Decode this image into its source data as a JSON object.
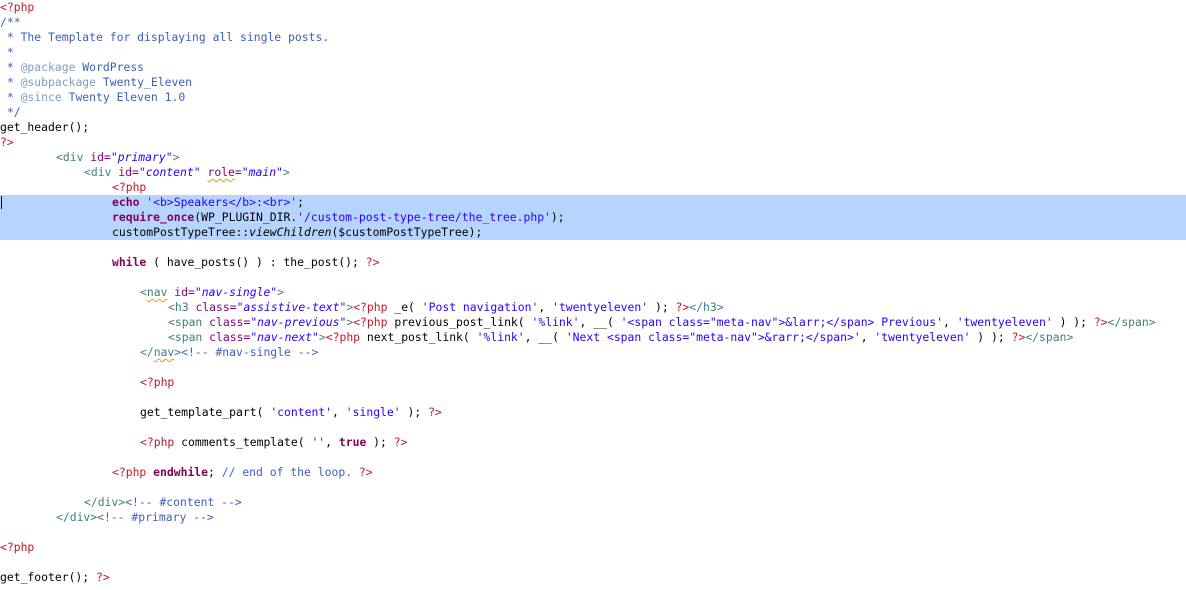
{
  "editor": {
    "language": "php",
    "selection_color": "#b5d5ff",
    "colors": {
      "php_tag": "#c0182a",
      "comment": "#3a5fbf",
      "doc_tag": "#7f9fbf",
      "keyword": "#7f0055",
      "string": "#2a00ff",
      "html_tag": "#3f7f7f",
      "html_attr": "#7f007f"
    },
    "lines": [
      {
        "indent": 0,
        "tokens": [
          {
            "t": "<?php",
            "c": "php-tag"
          }
        ]
      },
      {
        "indent": 0,
        "tokens": [
          {
            "t": "/**",
            "c": "cmt"
          }
        ]
      },
      {
        "indent": 0,
        "tokens": [
          {
            "t": " * The Template for displaying all single posts.",
            "c": "cmt"
          }
        ]
      },
      {
        "indent": 0,
        "tokens": [
          {
            "t": " *",
            "c": "cmt"
          }
        ]
      },
      {
        "indent": 0,
        "tokens": [
          {
            "t": " * ",
            "c": "cmt"
          },
          {
            "t": "@package",
            "c": "doc-tag"
          },
          {
            "t": " WordPress",
            "c": "cmt"
          }
        ]
      },
      {
        "indent": 0,
        "tokens": [
          {
            "t": " * ",
            "c": "cmt"
          },
          {
            "t": "@subpackage",
            "c": "doc-tag"
          },
          {
            "t": " Twenty_Eleven",
            "c": "cmt"
          }
        ]
      },
      {
        "indent": 0,
        "tokens": [
          {
            "t": " * ",
            "c": "cmt"
          },
          {
            "t": "@since",
            "c": "doc-tag"
          },
          {
            "t": " Twenty Eleven 1.0",
            "c": "cmt"
          }
        ]
      },
      {
        "indent": 0,
        "tokens": [
          {
            "t": " */",
            "c": "cmt"
          }
        ]
      },
      {
        "indent": 0,
        "tokens": [
          {
            "t": "get_header();",
            "c": "ident"
          }
        ]
      },
      {
        "indent": 0,
        "tokens": [
          {
            "t": "?>",
            "c": "php-tag"
          }
        ]
      },
      {
        "indent": 8,
        "tokens": [
          {
            "t": "<div ",
            "c": "html-tag"
          },
          {
            "t": "id=",
            "c": "attr"
          },
          {
            "t": "\"primary\"",
            "c": "attr-val"
          },
          {
            "t": ">",
            "c": "html-tag"
          }
        ]
      },
      {
        "indent": 12,
        "tokens": [
          {
            "t": "<div ",
            "c": "html-tag"
          },
          {
            "t": "id=",
            "c": "attr"
          },
          {
            "t": "\"content\"",
            "c": "attr-val"
          },
          {
            "t": " ",
            "c": "ident"
          },
          {
            "t": "role",
            "c": "attr squig"
          },
          {
            "t": "=",
            "c": "attr"
          },
          {
            "t": "\"main\"",
            "c": "attr-val"
          },
          {
            "t": ">",
            "c": "html-tag"
          }
        ]
      },
      {
        "indent": 16,
        "tokens": [
          {
            "t": "<?php",
            "c": "php-tag"
          }
        ]
      },
      {
        "indent": 16,
        "selected": true,
        "caret": true,
        "tokens": [
          {
            "t": "echo",
            "c": "kw"
          },
          {
            "t": " ",
            "c": "ident"
          },
          {
            "t": "'<b>Speakers</b>:<br>'",
            "c": "str"
          },
          {
            "t": ";",
            "c": "ident"
          }
        ]
      },
      {
        "indent": 16,
        "selected": true,
        "tokens": [
          {
            "t": "require_once",
            "c": "kw"
          },
          {
            "t": "(WP_PLUGIN_DIR.",
            "c": "ident"
          },
          {
            "t": "'/custom-post-type-tree/the_tree.php'",
            "c": "str"
          },
          {
            "t": ");",
            "c": "ident"
          }
        ]
      },
      {
        "indent": 16,
        "selected": true,
        "tokens": [
          {
            "t": "customPostTypeTree::",
            "c": "ident"
          },
          {
            "t": "viewChildren",
            "c": "ident ital"
          },
          {
            "t": "($customPostTypeTree);",
            "c": "ident"
          }
        ]
      },
      {
        "indent": 0,
        "tokens": []
      },
      {
        "indent": 16,
        "tokens": [
          {
            "t": "while",
            "c": "kw"
          },
          {
            "t": " ( have_posts() ) : the_post(); ",
            "c": "ident"
          },
          {
            "t": "?>",
            "c": "php-tag"
          }
        ]
      },
      {
        "indent": 0,
        "tokens": []
      },
      {
        "indent": 20,
        "tokens": [
          {
            "t": "<",
            "c": "html-tag"
          },
          {
            "t": "nav",
            "c": "html-tag squig"
          },
          {
            "t": " ",
            "c": "html-tag"
          },
          {
            "t": "id=",
            "c": "attr"
          },
          {
            "t": "\"nav-single\"",
            "c": "attr-val"
          },
          {
            "t": ">",
            "c": "html-tag"
          }
        ]
      },
      {
        "indent": 24,
        "tokens": [
          {
            "t": "<h3 ",
            "c": "html-tag"
          },
          {
            "t": "class=",
            "c": "attr"
          },
          {
            "t": "\"assistive-text\"",
            "c": "attr-val"
          },
          {
            "t": ">",
            "c": "html-tag"
          },
          {
            "t": "<?php",
            "c": "php-tag"
          },
          {
            "t": " _e( ",
            "c": "ident"
          },
          {
            "t": "'Post navigation'",
            "c": "str"
          },
          {
            "t": ", ",
            "c": "ident"
          },
          {
            "t": "'twentyeleven'",
            "c": "str"
          },
          {
            "t": " ); ",
            "c": "ident"
          },
          {
            "t": "?>",
            "c": "php-tag"
          },
          {
            "t": "</h3>",
            "c": "html-tag"
          }
        ]
      },
      {
        "indent": 24,
        "tokens": [
          {
            "t": "<span ",
            "c": "html-tag"
          },
          {
            "t": "class=",
            "c": "attr"
          },
          {
            "t": "\"nav-previous\"",
            "c": "attr-val"
          },
          {
            "t": ">",
            "c": "html-tag"
          },
          {
            "t": "<?php",
            "c": "php-tag"
          },
          {
            "t": " previous_post_link( ",
            "c": "ident"
          },
          {
            "t": "'%link'",
            "c": "str"
          },
          {
            "t": ", __( ",
            "c": "ident"
          },
          {
            "t": "'<span class=\"meta-nav\">&larr;</span> Previous'",
            "c": "str"
          },
          {
            "t": ", ",
            "c": "ident"
          },
          {
            "t": "'twentyeleven'",
            "c": "str"
          },
          {
            "t": " ) ); ",
            "c": "ident"
          },
          {
            "t": "?>",
            "c": "php-tag"
          },
          {
            "t": "</span>",
            "c": "html-tag"
          }
        ]
      },
      {
        "indent": 24,
        "tokens": [
          {
            "t": "<span ",
            "c": "html-tag"
          },
          {
            "t": "class=",
            "c": "attr"
          },
          {
            "t": "\"nav-next\"",
            "c": "attr-val"
          },
          {
            "t": ">",
            "c": "html-tag"
          },
          {
            "t": "<?php",
            "c": "php-tag"
          },
          {
            "t": " next_post_link( ",
            "c": "ident"
          },
          {
            "t": "'%link'",
            "c": "str"
          },
          {
            "t": ", __( ",
            "c": "ident"
          },
          {
            "t": "'Next <span class=\"meta-nav\">&rarr;</span>'",
            "c": "str"
          },
          {
            "t": ", ",
            "c": "ident"
          },
          {
            "t": "'twentyeleven'",
            "c": "str"
          },
          {
            "t": " ) ); ",
            "c": "ident"
          },
          {
            "t": "?>",
            "c": "php-tag"
          },
          {
            "t": "</span>",
            "c": "html-tag"
          }
        ]
      },
      {
        "indent": 20,
        "tokens": [
          {
            "t": "</",
            "c": "html-tag"
          },
          {
            "t": "nav",
            "c": "html-tag squig"
          },
          {
            "t": ">",
            "c": "html-tag"
          },
          {
            "t": "<!-- #nav-single -->",
            "c": "html-cmt"
          }
        ]
      },
      {
        "indent": 0,
        "tokens": []
      },
      {
        "indent": 20,
        "tokens": [
          {
            "t": "<?php",
            "c": "php-tag"
          }
        ]
      },
      {
        "indent": 0,
        "tokens": []
      },
      {
        "indent": 20,
        "tokens": [
          {
            "t": "get_template_part( ",
            "c": "ident"
          },
          {
            "t": "'content'",
            "c": "str"
          },
          {
            "t": ", ",
            "c": "ident"
          },
          {
            "t": "'single'",
            "c": "str"
          },
          {
            "t": " ); ",
            "c": "ident"
          },
          {
            "t": "?>",
            "c": "php-tag"
          }
        ]
      },
      {
        "indent": 0,
        "tokens": []
      },
      {
        "indent": 20,
        "tokens": [
          {
            "t": "<?php",
            "c": "php-tag"
          },
          {
            "t": " comments_template( ",
            "c": "ident"
          },
          {
            "t": "''",
            "c": "str"
          },
          {
            "t": ", ",
            "c": "ident"
          },
          {
            "t": "true",
            "c": "kw"
          },
          {
            "t": " ); ",
            "c": "ident"
          },
          {
            "t": "?>",
            "c": "php-tag"
          }
        ]
      },
      {
        "indent": 0,
        "tokens": []
      },
      {
        "indent": 16,
        "tokens": [
          {
            "t": "<?php",
            "c": "php-tag"
          },
          {
            "t": " ",
            "c": "ident"
          },
          {
            "t": "endwhile",
            "c": "kw"
          },
          {
            "t": "; ",
            "c": "ident"
          },
          {
            "t": "// end of the loop.",
            "c": "cmt"
          },
          {
            "t": " ",
            "c": "ident"
          },
          {
            "t": "?>",
            "c": "php-tag"
          }
        ]
      },
      {
        "indent": 0,
        "tokens": []
      },
      {
        "indent": 12,
        "tokens": [
          {
            "t": "</div>",
            "c": "html-tag"
          },
          {
            "t": "<!-- #content -->",
            "c": "html-cmt"
          }
        ]
      },
      {
        "indent": 8,
        "tokens": [
          {
            "t": "</div>",
            "c": "html-tag"
          },
          {
            "t": "<!-- #primary -->",
            "c": "html-cmt"
          }
        ]
      },
      {
        "indent": 0,
        "tokens": []
      },
      {
        "indent": 0,
        "tokens": [
          {
            "t": "<?php",
            "c": "php-tag"
          }
        ]
      },
      {
        "indent": 0,
        "tokens": []
      },
      {
        "indent": 0,
        "tokens": [
          {
            "t": "get_footer(); ",
            "c": "ident"
          },
          {
            "t": "?>",
            "c": "php-tag"
          }
        ]
      }
    ]
  }
}
